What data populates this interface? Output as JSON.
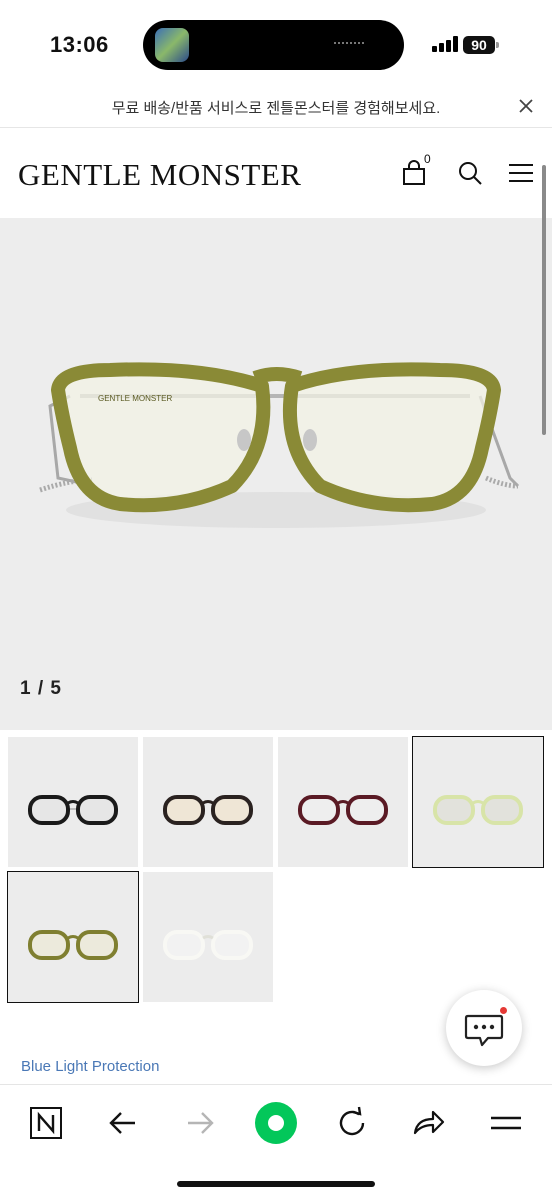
{
  "status_bar": {
    "time": "13:06",
    "battery": "90"
  },
  "promo": {
    "text": "무료 배송/반품 서비스로 젠틀몬스터를 경험해보세요."
  },
  "header": {
    "logo": "GENTLE MONSTER",
    "cart_count": "0"
  },
  "gallery": {
    "counter": "1 / 5",
    "frame_brand_mark": "GENTLE MONSTER",
    "thumbnails": [
      {
        "variant": "black",
        "selected": false
      },
      {
        "variant": "dark-tortoise",
        "selected": false
      },
      {
        "variant": "burgundy",
        "selected": false
      },
      {
        "variant": "clear-green",
        "selected": true
      },
      {
        "variant": "olive",
        "selected": true
      },
      {
        "variant": "clear",
        "selected": false
      }
    ]
  },
  "features": {
    "blue_light": "Blue Light Protection"
  },
  "browser_nav": {
    "icons": [
      "naver-n-icon",
      "back-arrow-icon",
      "forward-arrow-icon",
      "green-home-icon",
      "reload-icon",
      "share-icon",
      "menu-icon"
    ]
  },
  "colors": {
    "accent_green": "#03c75a",
    "link_blue": "#4a78b6",
    "chat_dot": "#e53935"
  }
}
